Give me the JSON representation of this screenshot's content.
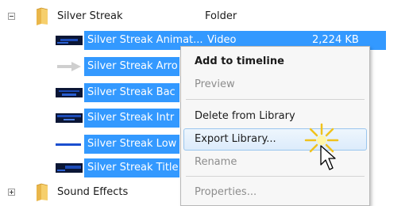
{
  "tree": {
    "folder1": {
      "name": "Silver Streak",
      "type": "Folder"
    },
    "items": [
      {
        "name": "Silver Streak Animat...",
        "type": "Video",
        "size": "2,224 KB",
        "thumb": "blue-video-thumbnail-icon"
      },
      {
        "name": "Silver Streak Arro",
        "type": "",
        "size": "",
        "thumb": "arrow-graphic-icon"
      },
      {
        "name": "Silver Streak Bac",
        "type": "",
        "size": "",
        "thumb": "blue-video-thumbnail-icon"
      },
      {
        "name": "Silver Streak Intr",
        "type": "",
        "size": "",
        "thumb": "blue-video-thumbnail-icon"
      },
      {
        "name": "Silver Streak Low",
        "type": "",
        "size": "",
        "thumb": "lower-third-bar-icon"
      },
      {
        "name": "Silver Streak Title",
        "type": "",
        "size": "",
        "thumb": "blue-video-thumbnail-icon"
      }
    ],
    "folder2": {
      "name": "Sound Effects"
    }
  },
  "context_menu": {
    "items": [
      {
        "label": "Add to timeline",
        "bold": true,
        "enabled": true
      },
      {
        "label": "Preview",
        "enabled": false
      },
      {
        "label": "Delete from Library",
        "enabled": true
      },
      {
        "label": "Export Library...",
        "enabled": true,
        "hovered": true
      },
      {
        "label": "Rename",
        "enabled": false
      },
      {
        "label": "Properties...",
        "enabled": false
      }
    ]
  },
  "colors": {
    "selection": "#3399ff",
    "menu_bg": "#f7f7f7",
    "hover_border": "#9ac6ee",
    "disabled": "#8d8d8d"
  }
}
